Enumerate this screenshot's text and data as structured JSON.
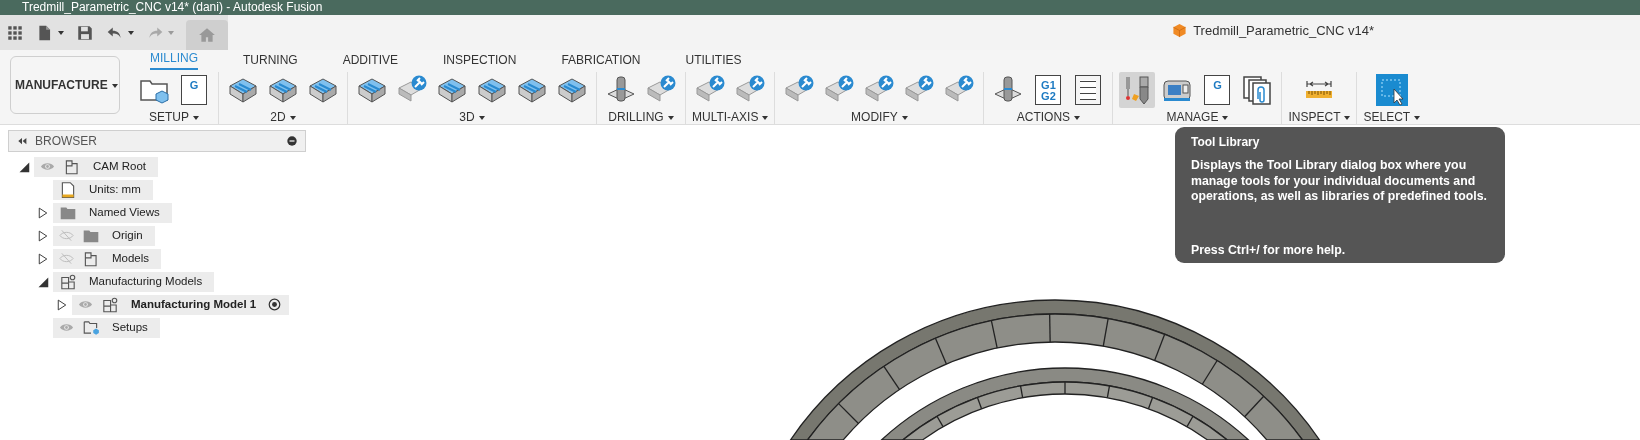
{
  "title_bar": {
    "title": "Tredmill_Parametric_CNC v14* (dani) - Autodesk Fusion"
  },
  "quick_access": [
    {
      "kind": "apps",
      "disabled": false
    },
    {
      "kind": "file",
      "disabled": false
    },
    {
      "kind": "save",
      "disabled": false
    },
    {
      "kind": "undo",
      "disabled": false
    },
    {
      "kind": "redo",
      "disabled": true
    },
    {
      "kind": "home",
      "disabled": false
    }
  ],
  "document_title": "Tredmill_Parametric_CNC v14*",
  "workspace": "MANUFACTURE",
  "tabs": [
    {
      "label": "MILLING",
      "selected": true
    },
    {
      "label": "TURNING",
      "selected": false
    },
    {
      "label": "ADDITIVE",
      "selected": false
    },
    {
      "label": "INSPECTION",
      "selected": false
    },
    {
      "label": "FABRICATION",
      "selected": false
    },
    {
      "label": "UTILITIES",
      "selected": false
    }
  ],
  "groups": [
    {
      "label": "SETUP",
      "tools": [
        {
          "kind": "folder",
          "selected": false
        },
        {
          "kind": "sheet",
          "glyph": "G",
          "selected": false
        }
      ]
    },
    {
      "label": "2D",
      "tools": [
        {
          "kind": "block",
          "selected": false
        },
        {
          "kind": "block",
          "selected": false
        },
        {
          "kind": "block",
          "selected": false
        }
      ]
    },
    {
      "label": "3D",
      "tools": [
        {
          "kind": "block",
          "selected": false
        },
        {
          "kind": "plug",
          "selected": false
        },
        {
          "kind": "block",
          "selected": false
        },
        {
          "kind": "block",
          "selected": false
        },
        {
          "kind": "block",
          "selected": false
        },
        {
          "kind": "block",
          "selected": false
        }
      ]
    },
    {
      "label": "DRILLING",
      "tools": [
        {
          "kind": "drill",
          "selected": false
        },
        {
          "kind": "plug",
          "selected": false
        }
      ]
    },
    {
      "label": "MULTI-AXIS",
      "tools": [
        {
          "kind": "plug",
          "selected": false
        },
        {
          "kind": "plug",
          "selected": false
        }
      ]
    },
    {
      "label": "MODIFY",
      "tools": [
        {
          "kind": "plug",
          "selected": false
        },
        {
          "kind": "plug",
          "selected": false
        },
        {
          "kind": "plug",
          "selected": false
        },
        {
          "kind": "plug",
          "selected": false
        },
        {
          "kind": "plug",
          "selected": false
        }
      ]
    },
    {
      "label": "ACTIONS",
      "tools": [
        {
          "kind": "drill",
          "selected": false
        },
        {
          "kind": "sheet",
          "glyph": "G1 G2",
          "selected": false
        },
        {
          "kind": "sheet",
          "selected": false
        }
      ]
    },
    {
      "label": "MANAGE",
      "tools": [
        {
          "kind": "mill",
          "selected": true
        },
        {
          "kind": "machine",
          "selected": false
        },
        {
          "kind": "sheet",
          "glyph": "G",
          "selected": false
        },
        {
          "kind": "pages",
          "selected": false
        }
      ]
    },
    {
      "label": "INSPECT",
      "tools": [
        {
          "kind": "ruler",
          "selected": false
        }
      ]
    },
    {
      "label": "SELECT",
      "tools": [
        {
          "kind": "select",
          "selected": false
        }
      ]
    }
  ],
  "browser": {
    "title": "BROWSER",
    "tree": [
      {
        "label": "CAM Root",
        "kind": "component",
        "visible": true,
        "expanded": true,
        "children": [
          {
            "label": "Units: mm",
            "kind": "units"
          },
          {
            "label": "Named Views",
            "kind": "folder",
            "expanded": false
          },
          {
            "label": "Origin",
            "kind": "folder",
            "visible": false,
            "expanded": false
          },
          {
            "label": "Models",
            "kind": "component",
            "visible": false,
            "expanded": false
          },
          {
            "label": "Manufacturing Models",
            "kind": "mfg",
            "expanded": true,
            "children": [
              {
                "label": "Manufacturing Model 1",
                "kind": "mfg",
                "visible": true,
                "expanded": false,
                "active": true
              }
            ]
          },
          {
            "label": "Setups",
            "kind": "setups",
            "visible": true
          }
        ]
      }
    ]
  },
  "tooltip": {
    "title": "Tool Library",
    "description": "Displays the Tool Library dialog box where you manage tools for your individual documents and operations, as well as libraries of predefined tools.",
    "hint": "Press Ctrl+/ for more help."
  }
}
